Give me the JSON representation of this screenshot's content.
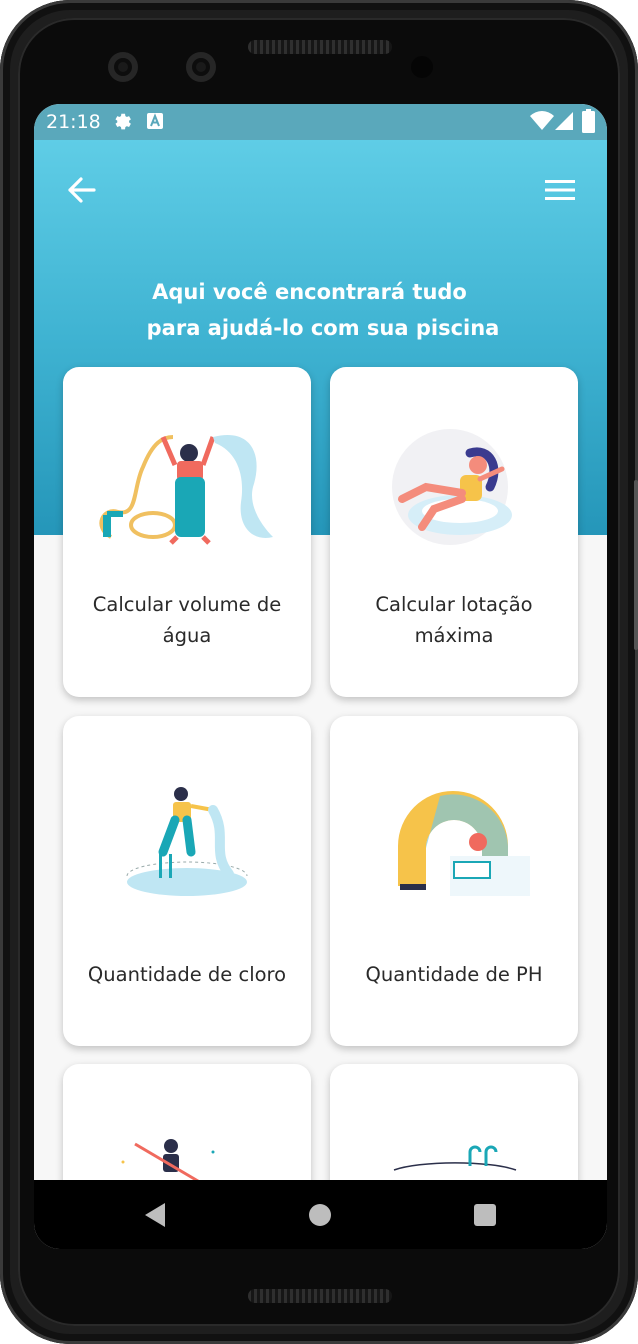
{
  "status_bar": {
    "time": "21:18",
    "icons": [
      "gear-icon",
      "a-box-icon",
      "wifi-icon",
      "signal-icon",
      "battery-icon"
    ]
  },
  "app_bar": {
    "back_icon": "arrow-left-icon",
    "menu_icon": "hamburger-menu-icon"
  },
  "hero": {
    "title_line_1": "Aqui você encontrará tudo",
    "title_line_2": "para ajudá-lo com sua piscina"
  },
  "cards": [
    {
      "label": "Calcular volume de água",
      "illustration": "hose-worker-illustration"
    },
    {
      "label": "Calcular lotação máxima",
      "illustration": "woman-on-float-illustration"
    },
    {
      "label": "Quantidade de cloro",
      "illustration": "pool-cleaner-illustration"
    },
    {
      "label": "Quantidade de PH",
      "illustration": "pool-tile-worker-illustration"
    },
    {
      "label": "",
      "illustration": "pool-net-worker-illustration"
    },
    {
      "label": "",
      "illustration": "pool-ladder-illustration"
    }
  ],
  "nav_bar": {
    "icons": [
      "back-triangle-icon",
      "home-circle-icon",
      "recents-square-icon"
    ]
  },
  "colors": {
    "hero_top": "#5fcde6",
    "hero_bottom": "#2596b9",
    "status_bar": "#5aa8bb",
    "card_bg": "#ffffff",
    "screen_bg": "#f7f7f7",
    "accent_teal": "#1aa7b6",
    "accent_coral": "#f06a5e",
    "accent_yellow": "#f6c34a"
  }
}
